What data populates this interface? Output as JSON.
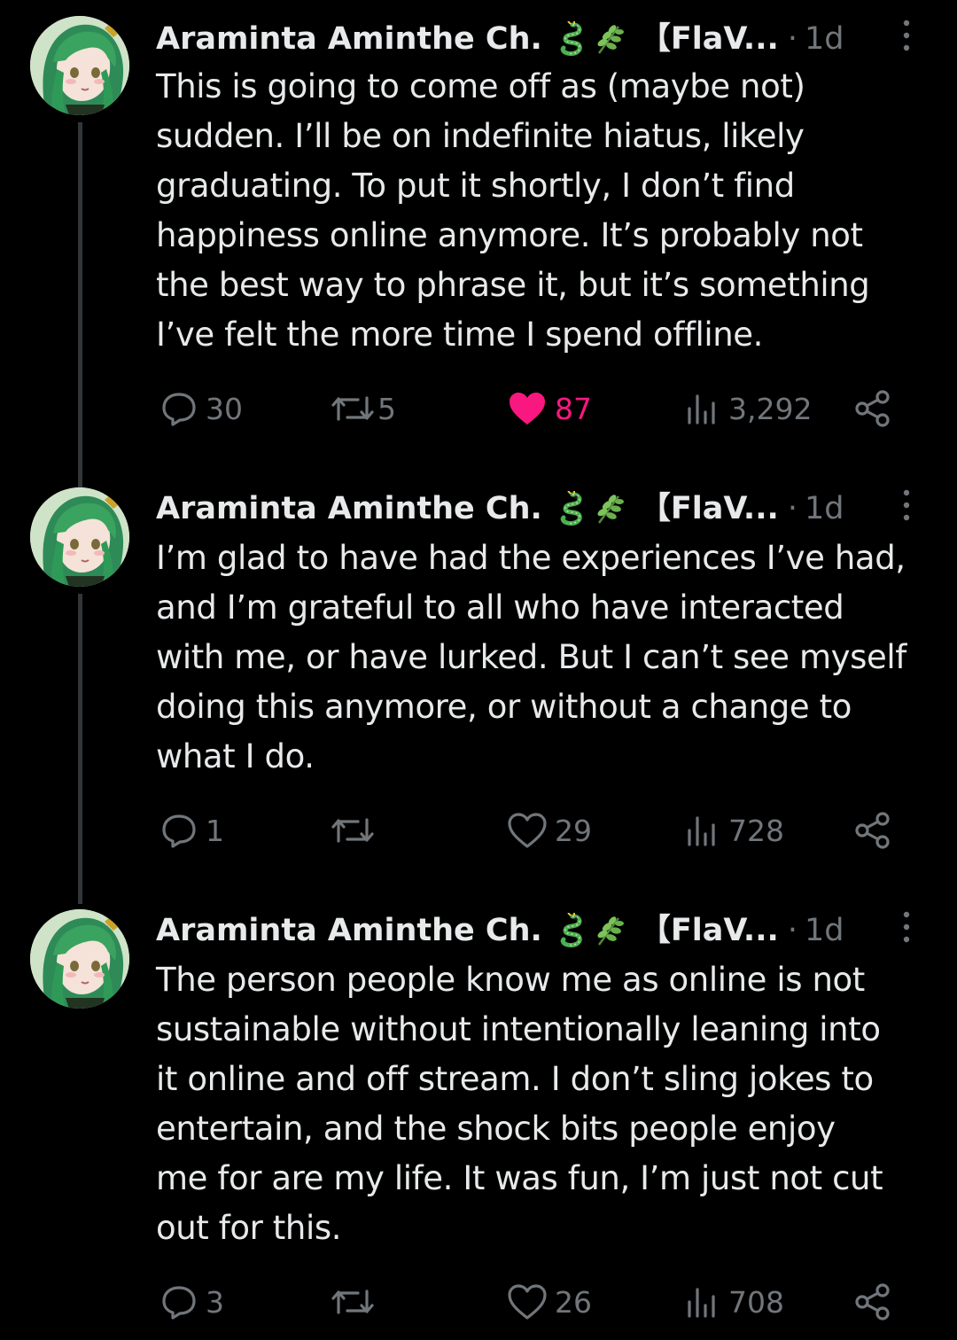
{
  "colors": {
    "background": "#000000",
    "text": "#e7e9ea",
    "muted": "#71767b",
    "like_active": "#f91880",
    "thread_line": "#333639"
  },
  "tweets": [
    {
      "author": "Araminta Aminthe Ch.",
      "badges": [
        "dragon-emoji",
        "herb-emoji"
      ],
      "handle": "【FlaV...",
      "separator": "·",
      "time": "1d",
      "text": "This is going to come off as (maybe not)\nsudden. I’ll be on indefinite hiatus, likely\ngraduating. To put it shortly, I don’t find\nhappiness online anymore. It’s probably not\nthe best way to phrase it, but it’s something\nI’ve felt the more time I spend offline.",
      "replies": "30",
      "retweets": "5",
      "likes": "87",
      "liked": true,
      "views": "3,292"
    },
    {
      "author": "Araminta Aminthe Ch.",
      "badges": [
        "dragon-emoji",
        "herb-emoji"
      ],
      "handle": "【FlaV...",
      "separator": "·",
      "time": "1d",
      "text": "I’m glad to have had the experiences I’ve had,\nand I’m grateful to all who have interacted\nwith me, or have lurked. But I can’t see myself\ndoing this anymore, or without a change to\nwhat I do.",
      "replies": "1",
      "retweets": "",
      "likes": "29",
      "liked": false,
      "views": "728"
    },
    {
      "author": "Araminta Aminthe Ch.",
      "badges": [
        "dragon-emoji",
        "herb-emoji"
      ],
      "handle": "【FlaV...",
      "separator": "·",
      "time": "1d",
      "text": "The person people know me as online is not\nsustainable without intentionally leaning into\nit online and off stream. I don’t sling jokes to\nentertain, and the shock bits people enjoy\nme for are my life. It was fun, I’m just not cut\nout for this.",
      "replies": "3",
      "retweets": "",
      "likes": "26",
      "liked": false,
      "views": "708"
    }
  ]
}
